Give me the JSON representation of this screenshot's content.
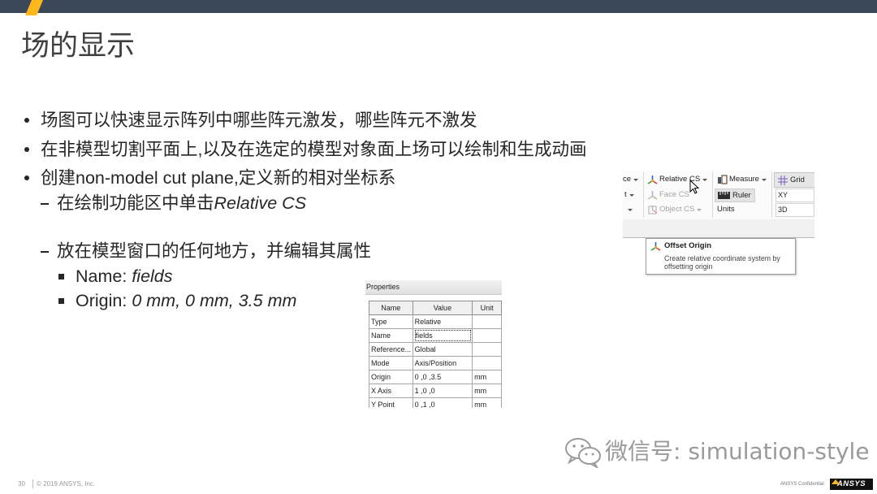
{
  "colors": {
    "top_bar": "#3b4859",
    "accent": "#ffb71b",
    "title": "#404040",
    "text": "#262626",
    "watermark": "#9a9a9a"
  },
  "slide": {
    "title": "场的显示",
    "bullets": [
      "场图可以快速显示阵列中哪些阵元激发，哪些阵元不激发",
      "在非模型切割平面上,以及在选定的模型对象面上场可以绘制和生成动画",
      "创建non-model cut plane,定义新的相对坐标系"
    ],
    "sub_bullets": [
      {
        "text": "在绘制功能区中单击",
        "emphasis": "Relative CS"
      },
      {
        "text": "放在模型窗口的任何地方，并编辑其属性"
      }
    ],
    "property_items": [
      {
        "label": "Name:",
        "value": "fields"
      },
      {
        "label": "Origin:",
        "value": "0 mm, 0 mm, 3.5 mm"
      }
    ]
  },
  "ribbon": {
    "partial_col": [
      "ce",
      "t",
      ""
    ],
    "cs_group": [
      {
        "label": "Relative CS",
        "icon": "relative-cs-icon",
        "enabled": true
      },
      {
        "label": "Face CS",
        "icon": "face-cs-icon",
        "enabled": false
      },
      {
        "label": "Object CS",
        "icon": "object-cs-icon",
        "enabled": false
      }
    ],
    "measure_group": [
      {
        "label": "Measure",
        "icon": "measure-icon"
      },
      {
        "label": "Ruler",
        "icon": "ruler-icon",
        "toggled": true
      },
      {
        "label": "Units"
      }
    ],
    "grid_group": {
      "grid_label": "Grid",
      "grid_icon": "grid-icon",
      "plane": "XY",
      "mode": "3D"
    },
    "tooltip": {
      "icon": "offset-origin-icon",
      "title": "Offset Origin",
      "lines": [
        "Create relative coordinate system by",
        "offsetting origin"
      ]
    }
  },
  "properties_panel": {
    "title": "Properties",
    "columns": {
      "name": "Name",
      "value": "Value",
      "unit": "Unit"
    },
    "rows": [
      {
        "name": "Type",
        "value": "Relative",
        "unit": ""
      },
      {
        "name": "Name",
        "value": "fields",
        "unit": ""
      },
      {
        "name": "Reference...",
        "value": "Global",
        "unit": ""
      },
      {
        "name": "Mode",
        "value": "Axis/Position",
        "unit": ""
      },
      {
        "name": "Origin",
        "value": "0 ,0 ,3.5",
        "unit": "mm"
      },
      {
        "name": "X Axis",
        "value": "1 ,0 ,0",
        "unit": "mm"
      },
      {
        "name": "Y Point",
        "value": "0 ,1 ,0",
        "unit": "mm"
      }
    ]
  },
  "watermark": {
    "icon": "wechat-icon",
    "text": "微信号: simulation-style"
  },
  "footer": {
    "page_number": "30",
    "copyright": "© 2019 ANSYS, Inc.",
    "confidential": "ANSYS Confidential",
    "logo_text": "ANSYS"
  }
}
